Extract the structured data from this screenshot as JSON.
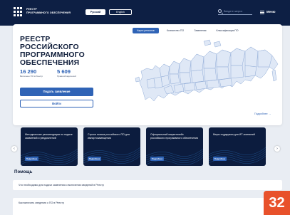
{
  "header": {
    "logo_line1": "РЕЕСТР",
    "logo_line2": "ПРОГРАММНОГО ОБЕСПЕЧЕНИЯ",
    "lang_ru": "Русский",
    "lang_en": "English",
    "search_placeholder": "Введите запрос",
    "menu_label": "Меню"
  },
  "hero": {
    "title_lines": [
      "РЕЕСТР",
      "РОССИЙСКОГО",
      "ПРОГРАММНОГО",
      "ОБЕСПЕЧЕНИЯ"
    ],
    "stats": [
      {
        "value": "16 290",
        "label": "Включено ПО в Реестр"
      },
      {
        "value": "5 609",
        "label": "Правообладателей"
      }
    ],
    "submit_button": "Подать заявление",
    "login_button": "Войти",
    "tabs": [
      {
        "label": "Карта регионов",
        "active": true
      },
      {
        "label": "Количество ПО",
        "active": false
      },
      {
        "label": "Заявления",
        "active": false
      },
      {
        "label": "Классификация ПО",
        "active": false
      }
    ],
    "more_link": "Подробнее →"
  },
  "carousel": {
    "cards": [
      {
        "text": "Методические рекомендации по подаче заявлений и уведомлений",
        "button": "Подробнее"
      },
      {
        "text": "Строки поиска российского ПО для импортозамещения",
        "button": "Подробнее"
      },
      {
        "text": "Официальный маркетплейс российского программного обеспечения",
        "button": "Подробнее"
      },
      {
        "text": "Меры поддержки для ИТ-компаний",
        "button": "Подробнее"
      }
    ]
  },
  "help": {
    "title": "Помощь",
    "items": [
      "Что необходимо для подачи заявления о включении сведений в Реестр",
      "Как включить сведения о ПО в Реестр"
    ]
  },
  "page_badge": "32",
  "colors": {
    "header_bg": "#0d1f44",
    "accent": "#2f63b6",
    "badge": "#e8512b",
    "map_fill": "#dfe8f6"
  }
}
